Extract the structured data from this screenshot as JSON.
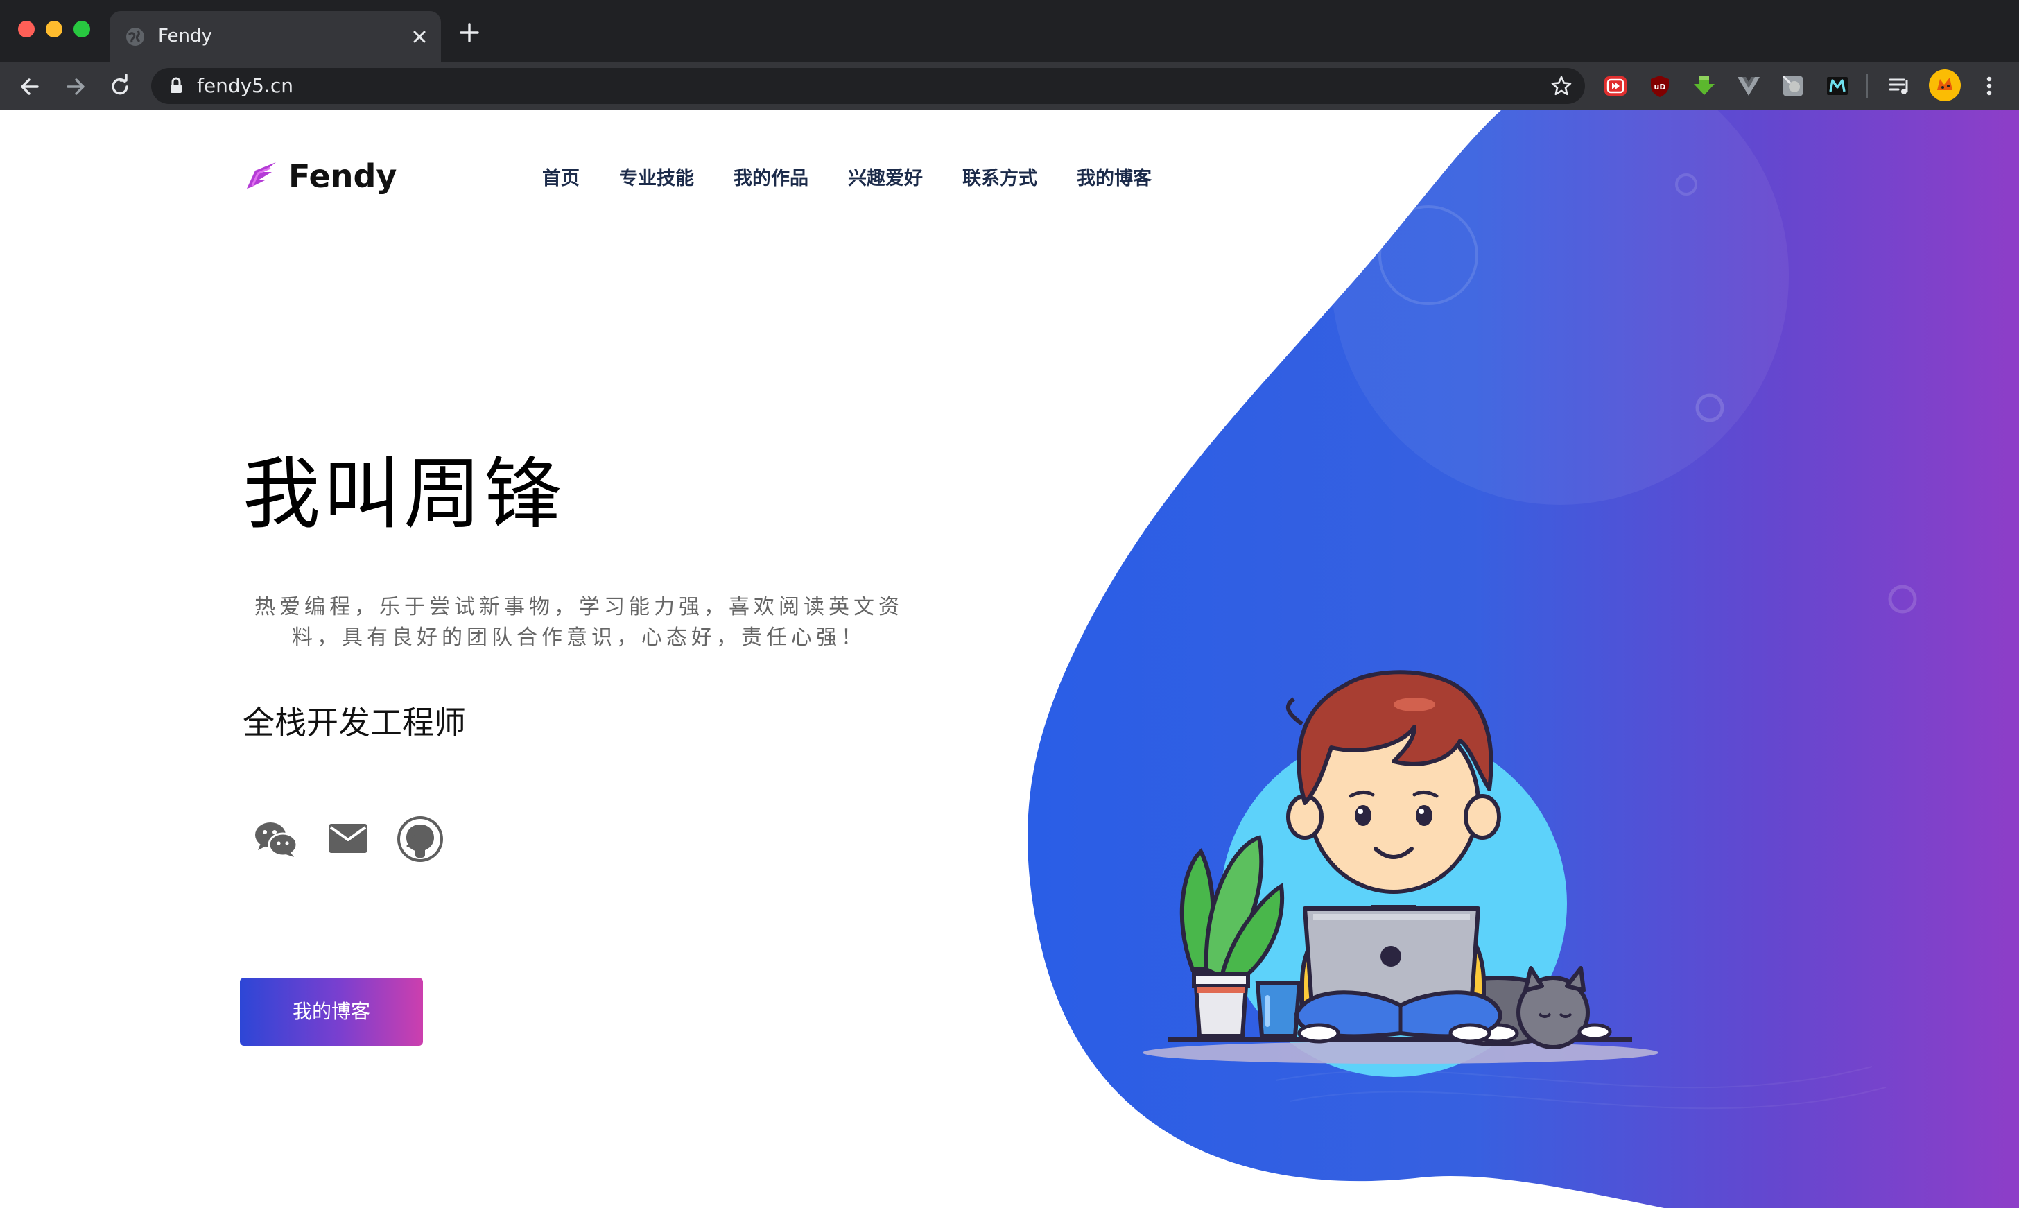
{
  "browser": {
    "tab_title": "Fendy",
    "url": "fendy5.cn"
  },
  "site": {
    "logo_text": "Fendy",
    "nav": [
      "首页",
      "专业技能",
      "我的作品",
      "兴趣爱好",
      "联系方式",
      "我的博客"
    ]
  },
  "hero": {
    "title": "我叫周锋",
    "description": "热爱编程，乐于尝试新事物，学习能力强，喜欢阅读英文资料，具有良好的团队合作意识，心态好，责任心强！",
    "role": "全栈开发工程师",
    "social_icons": [
      "wechat-icon",
      "mail-icon",
      "github-icon"
    ],
    "blog_button": "我的博客"
  },
  "colors": {
    "chrome_dark": "#202124",
    "chrome_toolbar": "#35363a",
    "blob_blue": "#2a5ee6",
    "blob_purple": "#8e3ec8",
    "nav_text": "#1c2b4a",
    "button_start": "#2d46d6",
    "button_end": "#cc3fae"
  }
}
